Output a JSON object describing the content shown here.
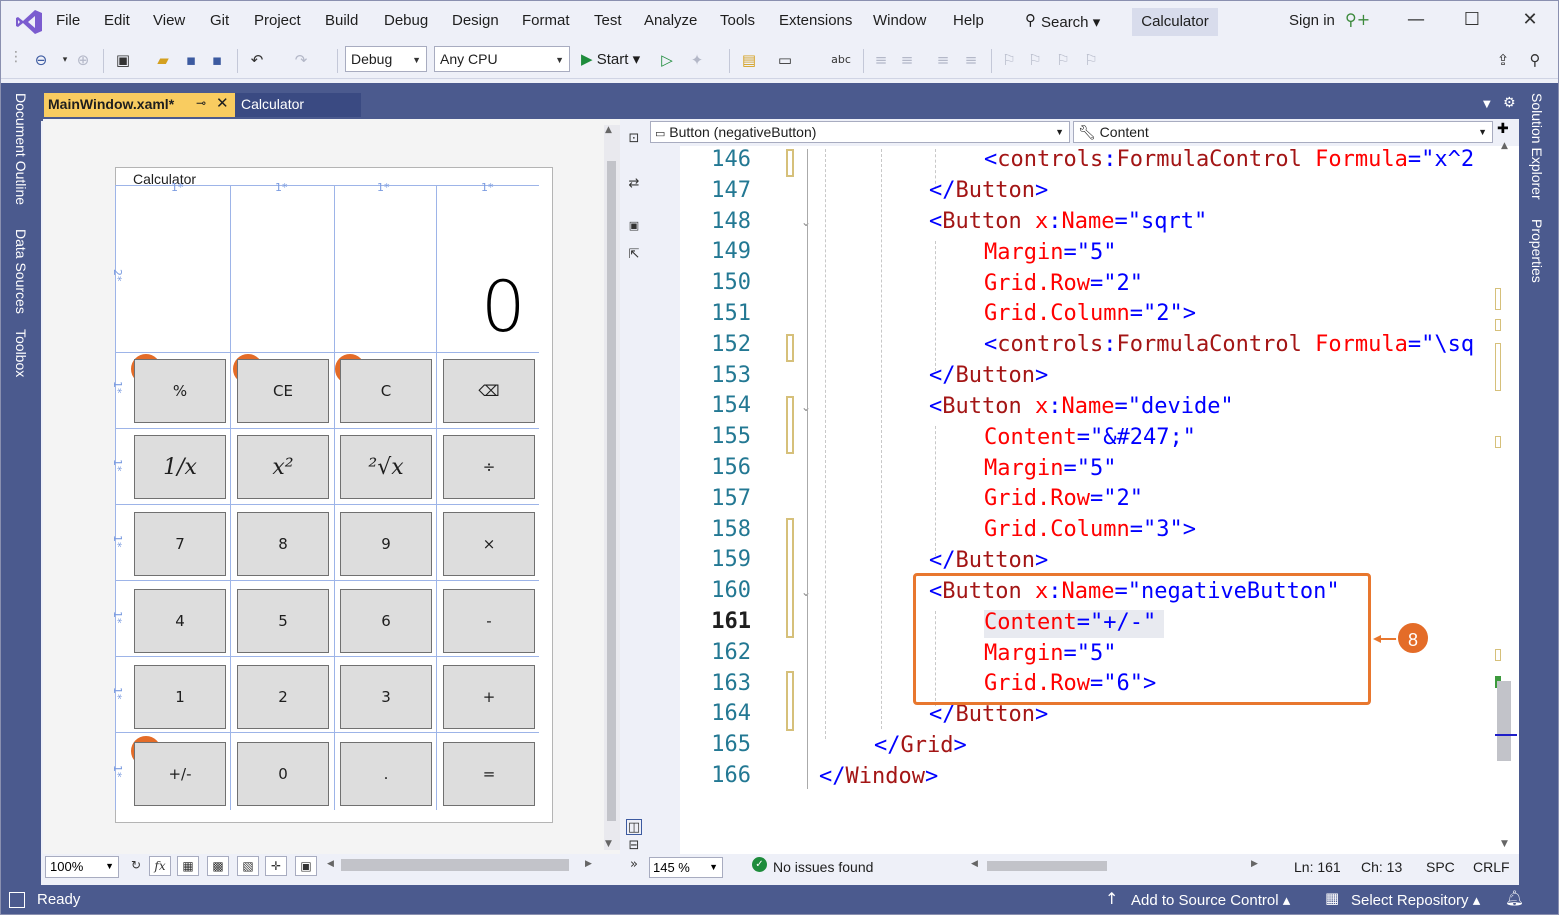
{
  "menu": {
    "items": [
      "File",
      "Edit",
      "View",
      "Git",
      "Project",
      "Build",
      "Debug",
      "Design",
      "Format",
      "Test",
      "Analyze",
      "Tools",
      "Extensions",
      "Window",
      "Help"
    ],
    "search_label": "Search",
    "window_title": "Calculator",
    "sign_in": "Sign in"
  },
  "toolbar": {
    "config_value": "Debug",
    "platform_value": "Any CPU",
    "start_label": "Start"
  },
  "left_panels": [
    "Document Outline",
    "Data Sources",
    "Toolbox"
  ],
  "right_panels": [
    "Solution Explorer",
    "Properties"
  ],
  "tabs": [
    {
      "label": "MainWindow.xaml*",
      "active": true
    },
    {
      "label": "Calculator",
      "active": false
    }
  ],
  "designer": {
    "window_title": "Calculator",
    "display_value": "0",
    "column_marks": [
      "1*",
      "1*",
      "1*",
      "1*"
    ],
    "row_marks": [
      "2*",
      "1*",
      "1*",
      "1*",
      "1*",
      "1*",
      "1*"
    ],
    "buttons": [
      [
        "%",
        "CE",
        "C",
        "⌫"
      ],
      [
        "1/x",
        "x²",
        "²√x",
        "÷"
      ],
      [
        "7",
        "8",
        "9",
        "×"
      ],
      [
        "4",
        "5",
        "6",
        "-"
      ],
      [
        "1",
        "2",
        "3",
        "+"
      ],
      [
        "+/-",
        "0",
        ".",
        "="
      ]
    ],
    "badges": [
      "5",
      "6",
      "7",
      "8"
    ],
    "zoom": "100%"
  },
  "editor": {
    "nav_left": "Button (negativeButton)",
    "nav_right": "Content",
    "line_numbers": [
      "146",
      "147",
      "148",
      "149",
      "150",
      "151",
      "152",
      "153",
      "154",
      "155",
      "156",
      "157",
      "158",
      "159",
      "160",
      "161",
      "162",
      "163",
      "164",
      "165",
      "166"
    ],
    "current_line": "161",
    "callout_badge": "8",
    "zoom": "145 %",
    "issues": "No issues found",
    "ln": "Ln: 161",
    "ch": "Ch: 13",
    "spc": "SPC",
    "crlf": "CRLF"
  },
  "status": {
    "ready": "Ready",
    "add_source": "Add to Source Control",
    "select_repo": "Select Repository"
  },
  "colors": {
    "accent": "#4b5a8e",
    "active_tab": "#f9cc60",
    "badge": "#e46c28"
  }
}
